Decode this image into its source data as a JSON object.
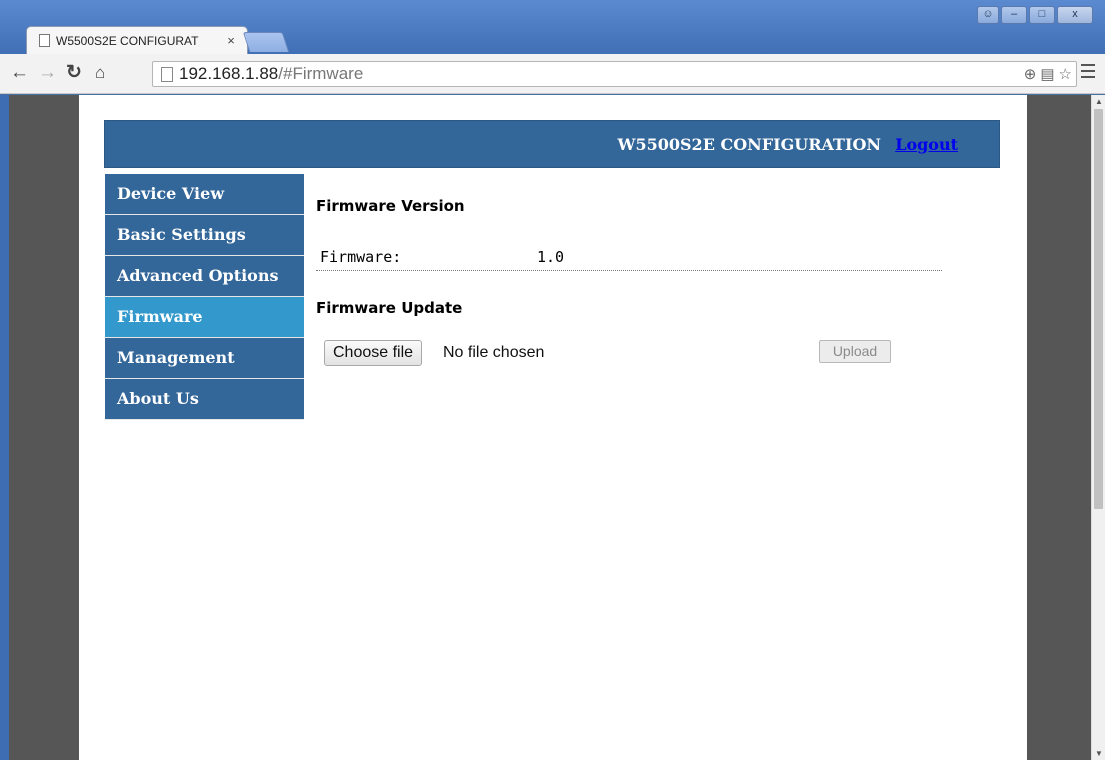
{
  "browser": {
    "tab_title": "W5500S2E CONFIGURAT",
    "tab_close": "×",
    "url_host": "192.168.1.88",
    "url_path": "/#Firmware"
  },
  "header": {
    "title": "W5500S2E CONFIGURATION",
    "logout": "Logout"
  },
  "sidebar": {
    "items": [
      {
        "label": "Device View",
        "active": false
      },
      {
        "label": "Basic Settings",
        "active": false
      },
      {
        "label": "Advanced Options",
        "active": false
      },
      {
        "label": "Firmware",
        "active": true
      },
      {
        "label": "Management",
        "active": false
      },
      {
        "label": "About Us",
        "active": false
      }
    ]
  },
  "firmware_version": {
    "title": "Firmware Version",
    "label": "Firmware:",
    "value": "1.0"
  },
  "firmware_update": {
    "title": "Firmware Update",
    "choose_label": "Choose file",
    "file_status": "No file chosen",
    "upload_label": "Upload"
  },
  "colors": {
    "nav_bg": "#336699",
    "nav_active": "#3399cc",
    "header_bg": "#336699"
  }
}
